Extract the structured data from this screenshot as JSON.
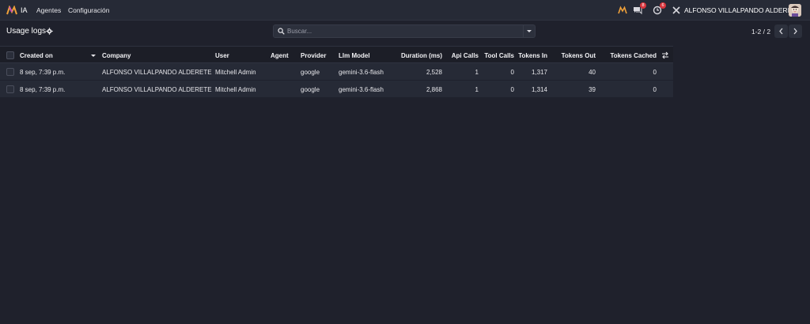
{
  "navbar": {
    "app_name": "IA",
    "menu": [
      "Agentes",
      "Configuración"
    ],
    "messages_count": "8",
    "activities_count": "6",
    "user_name": "ALFONSO VILLALPANDO ALDERETE"
  },
  "control": {
    "title": "Usage logs",
    "search_placeholder": "Buscar...",
    "pager": "1-2 / 2"
  },
  "table": {
    "columns": [
      "Created on",
      "Company",
      "User",
      "Agent",
      "Provider",
      "Llm Model",
      "Duration (ms)",
      "Api Calls",
      "Tool Calls",
      "Tokens In",
      "Tokens Out",
      "Tokens Cached"
    ],
    "rows": [
      [
        "8 sep, 7:39 p.m.",
        "ALFONSO VILLALPANDO ALDERETE",
        "Mitchell Admin",
        "",
        "google",
        "gemini-3.6-flash",
        "2,528",
        "1",
        "0",
        "1,317",
        "40",
        "0"
      ],
      [
        "8 sep, 7:39 p.m.",
        "ALFONSO VILLALPANDO ALDERETE",
        "Mitchell Admin",
        "",
        "google",
        "gemini-3.6-flash",
        "2,868",
        "1",
        "0",
        "1,314",
        "39",
        "0"
      ]
    ]
  },
  "icons": {
    "accent": "#7c4dff",
    "badge_color": "#d8343c"
  }
}
